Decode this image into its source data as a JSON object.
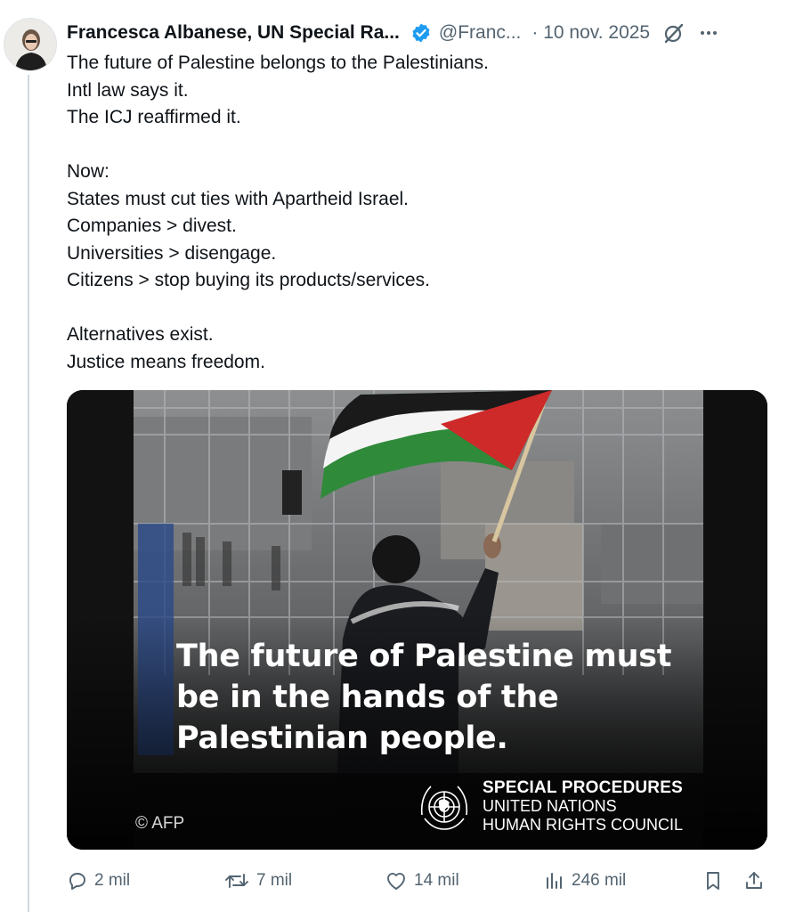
{
  "author": {
    "name": "Francesca Albanese, UN Special Ra...",
    "handle": "@Franc...",
    "date": "· 10 nov. 2025"
  },
  "icons": {
    "verified": "verified-badge-icon",
    "grok": "grok-icon",
    "more": "more-options-icon"
  },
  "tweet": {
    "lines": [
      "The future of Palestine belongs to the Palestinians.",
      "Intl law says it.",
      "The ICJ reaffirmed it.",
      "",
      "Now:",
      "States must cut ties with Apartheid Israel.",
      "Companies > divest.",
      "Universities > disengage.",
      "Citizens > stop buying its products/services.",
      "",
      "Alternatives exist.",
      "Justice means freedom."
    ]
  },
  "media": {
    "headline": [
      "The future of Palestine must",
      "be in the hands of the",
      "Palestinian people."
    ],
    "org_line1": "SPECIAL PROCEDURES",
    "org_line2": "UNITED NATIONS",
    "org_line3": "HUMAN RIGHTS COUNCIL",
    "credit": "© AFP"
  },
  "actions": {
    "replies": "2 mil",
    "reposts": "7 mil",
    "likes": "14 mil",
    "views": "246 mil"
  },
  "colors": {
    "verified_blue": "#1d9bf0",
    "text": "#0f1419",
    "secondary": "#536471",
    "flag_red": "#ce2a2a",
    "flag_green": "#2f8a3a"
  }
}
